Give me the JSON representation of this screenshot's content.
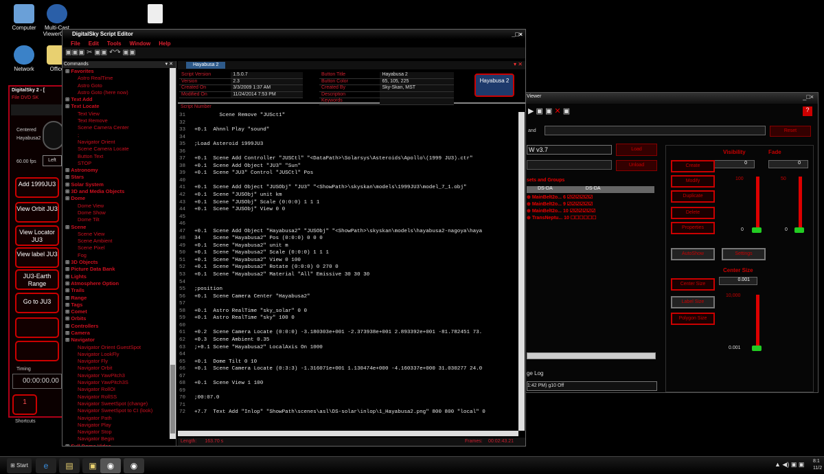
{
  "desktop": {
    "icons": [
      {
        "label": "Computer"
      },
      {
        "label": "Multi-Cast ViewerCast"
      },
      {
        "label": "Network"
      },
      {
        "label": "Office"
      }
    ]
  },
  "dome": {
    "title": "DigitalSky 2 - [",
    "menu": "File  DVD  SK",
    "label_center": "Centered",
    "label_obj": "Hayabusa2",
    "fps": "60.00 fps",
    "mode": "Left",
    "buttons": [
      "Add 1999JU3",
      "View Orbit JU3",
      "View Locator JU3",
      "View label JU3",
      "JU3-Earth Range",
      "Go to JU3"
    ],
    "timing_label": "Timing",
    "timecode": "00:00:00.00",
    "counter": "1",
    "footer": "Shortcuts"
  },
  "editor": {
    "title": "DigitalSky Script Editor",
    "menu": [
      "File",
      "Edit",
      "Tools",
      "Window",
      "Help"
    ],
    "panel_title": "Commands",
    "tab": "Hayabusa 2",
    "tree": [
      {
        "t": "Favorites",
        "c": 1
      },
      {
        "t": "Astro RealTime"
      },
      {
        "t": "Astro Goto"
      },
      {
        "t": "Astro Goto (here now)"
      },
      {
        "t": "Text Add",
        "c": 1
      },
      {
        "t": "Text Locate",
        "c": 1
      },
      {
        "t": "Text View"
      },
      {
        "t": "Text Remove"
      },
      {
        "t": "Scene Camera Center"
      },
      {
        "t": ";"
      },
      {
        "t": "Navigator Orient"
      },
      {
        "t": "Scene Camera Locate"
      },
      {
        "t": "Button Text"
      },
      {
        "t": "STOP"
      },
      {
        "t": "Astronomy",
        "c": 1
      },
      {
        "t": "Stars",
        "c": 1
      },
      {
        "t": "Solar System",
        "c": 1
      },
      {
        "t": "3D and Media Objects",
        "c": 1
      },
      {
        "t": "Dome",
        "c": 1
      },
      {
        "t": "Dome View"
      },
      {
        "t": "Dome Show"
      },
      {
        "t": "Dome Tilt"
      },
      {
        "t": "Scene",
        "c": 1
      },
      {
        "t": "Scene View"
      },
      {
        "t": "Scene Ambient"
      },
      {
        "t": "Scene Pixel"
      },
      {
        "t": "Fog"
      },
      {
        "t": "3D Objects",
        "c": 1
      },
      {
        "t": "Picture Data Bank",
        "c": 1
      },
      {
        "t": "Lights",
        "c": 1
      },
      {
        "t": "Atmosphere Option",
        "c": 1
      },
      {
        "t": "Trails",
        "c": 1
      },
      {
        "t": "Range",
        "c": 1
      },
      {
        "t": "Tags",
        "c": 1
      },
      {
        "t": "Comet",
        "c": 1
      },
      {
        "t": "Orbits",
        "c": 1
      },
      {
        "t": "Controllers",
        "c": 1
      },
      {
        "t": "Camera",
        "c": 1
      },
      {
        "t": "Navigator",
        "c": 1
      },
      {
        "t": "Navigator Orient GuestSpot"
      },
      {
        "t": "Navigator LookFly"
      },
      {
        "t": "Navigator Fly"
      },
      {
        "t": "Navigator Orbit"
      },
      {
        "t": "Navigator YawPitch3"
      },
      {
        "t": "Navigator YawPitch3S"
      },
      {
        "t": "Navigator RollOI"
      },
      {
        "t": "Navigator RollSS"
      },
      {
        "t": "Navigator SweetSpot (change)"
      },
      {
        "t": "Navigator SweetSpot to CI (look)"
      },
      {
        "t": "Navigator Path"
      },
      {
        "t": "Navigator Play"
      },
      {
        "t": "Navigator Stop"
      },
      {
        "t": "Navigator Begin"
      },
      {
        "t": "Full Dome Video",
        "c": 1
      }
    ],
    "props_left": [
      [
        "Script Version",
        "1.5.0.7"
      ],
      [
        "Version",
        "2.3"
      ],
      [
        "Created On",
        "3/3/2009 1:37 AM"
      ],
      [
        "Modified On",
        "11/24/2014 7:53 PM"
      ]
    ],
    "props_right": [
      [
        "Button Title",
        "Hayabusa 2"
      ],
      [
        "Button Color",
        "65, 105, 225"
      ],
      [
        "Created By",
        "Sky-Skan, MST"
      ],
      [
        "Description",
        ""
      ],
      [
        "Keywords",
        ""
      ]
    ],
    "button_preview": "Hayabusa 2",
    "script_header": "Script Number",
    "lines": [
      [
        "31",
        "        Scene Remove \"JUSct1\""
      ],
      [
        "32",
        ""
      ],
      [
        "33",
        "+0.1  Ahnnl Play \"sound\""
      ],
      [
        "34",
        ""
      ],
      [
        "35",
        ";Load Asteroid 1999JU3"
      ],
      [
        "36",
        ""
      ],
      [
        "37",
        "+0.1  Scene Add Controller \"JUSCtl\" \"<DataPath>\\Solarsys\\Asteroids\\Apollo\\(1999 JU3).ctr\""
      ],
      [
        "38",
        "+0.1  Scene Add Object \"JU3\" \"Sun\""
      ],
      [
        "39",
        "+0.1  Scene \"JU3\" Control \"JUSCtl\" Pos"
      ],
      [
        "40",
        ""
      ],
      [
        "41",
        "+0.1  Scene Add Object \"JUSObj\" \"JU3\" \"<ShowPath>\\skyskan\\models\\1999JU3\\model_7_1.obj\""
      ],
      [
        "42",
        "+0.1  Scene \"JUSObj\" unit km"
      ],
      [
        "43",
        "+0.1  Scene \"JUSObj\" Scale (0:0:0) 1 1 1"
      ],
      [
        "44",
        "+0.1  Scene \"JUSObj\" View 0 0"
      ],
      [
        "45",
        ""
      ],
      [
        "46",
        ""
      ],
      [
        "47",
        "+0.1  Scene Add Object \"Hayabusa2\" \"JUSObj\" \"<ShowPath>\\skyskan\\models\\hayabusa2-nagoya\\haya"
      ],
      [
        "48",
        "34    Scene \"Hayabusa2\" Pos (0:0:0) 0 0 0"
      ],
      [
        "49",
        "+0.1  Scene \"Hayabusa2\" unit m"
      ],
      [
        "50",
        "+0.1  Scene \"Hayabusa2\" Scale (0:0:0) 1 1 1"
      ],
      [
        "51",
        "+0.1  Scene \"Hayabusa2\" View 0 100"
      ],
      [
        "52",
        "+0.1  Scene \"Hayabusa2\" Rotate (0:0:0) 0 270 0"
      ],
      [
        "53",
        "+0.1  Scene \"Hayabusa2\" Material \"All\" Emissive 30 30 30"
      ],
      [
        "54",
        ""
      ],
      [
        "55",
        ";position"
      ],
      [
        "56",
        "+0.1  Scene Camera Center \"Hayabusa2\""
      ],
      [
        "57",
        ""
      ],
      [
        "58",
        "+0.1  Astro RealTime \"sky_solar\" 0 0"
      ],
      [
        "59",
        "+0.1  Astro RealTime \"sky\" 100 0"
      ],
      [
        "60",
        ""
      ],
      [
        "61",
        "+0.2  Scene Camera Locate (0:0:0) -3.180303e+001 -2.373938e+001 2.893392e+001 -81.782451 73."
      ],
      [
        "62",
        "+0.3  Scene Ambient 0.35"
      ],
      [
        "63",
        ";+0.1 Scene \"Hayabusa2\" LocalAxis On 1000"
      ],
      [
        "64",
        ""
      ],
      [
        "65",
        "+0.1  Dome Tilt 0 10"
      ],
      [
        "66",
        "+0.1  Scene Camera Locate (0:3:3) -1.316071e+001 1.130474e+000 -4.160337e+000 31.030277 24.0"
      ],
      [
        "67",
        ""
      ],
      [
        "68",
        "+0.1  Scene View 1 100"
      ],
      [
        "69",
        ""
      ],
      [
        "70",
        ";00:07.0"
      ],
      [
        "71",
        ""
      ],
      [
        "72",
        "+7.7  Text Add \"Inlop\" \"ShowPath\\scenes\\asl\\DS-solar\\inlop\\1_Hayabusa2.png\" 800 800 \"local\" 0"
      ]
    ],
    "length_label": "Length:",
    "length_value": "163.70 s",
    "frames_label": "Frames:",
    "frames_value": "00:02:43.21"
  },
  "viewer": {
    "title": "Viewer",
    "cmd_label": "and",
    "reset": "Reset",
    "object": "W v3.7",
    "load": "Load",
    "unload": "Unload",
    "sets_title": "sets and Groups",
    "col1": "DS-DA",
    "col2": "DS-DA",
    "rows": [
      {
        "name": "MainBelt2o...",
        "n": "6"
      },
      {
        "name": "MainBelt2o...",
        "n": "9"
      },
      {
        "name": "MainBelt2o...",
        "n": "10"
      },
      {
        "name": "TransNeptu...",
        "n": "10"
      }
    ],
    "visibility": "Visibility",
    "fade": "Fade",
    "vis_value": "0",
    "fade_value": "0",
    "v100": "100",
    "f50": "50",
    "v0": "0",
    "f0": "0",
    "side_buttons": [
      "Create",
      "Modify",
      "Duplicate",
      "Delete",
      "Properties"
    ],
    "autoshow": "AutoShow",
    "settings": "Settings",
    "center_size": "Center Size",
    "cs_value": "0.001",
    "cs_top": "10,000",
    "cs_bot": "0.001",
    "btn_a": "Center Size",
    "btn_b": "Label Size",
    "btn_c": "Polygon Size",
    "log_title": "ge Log",
    "log_value": "1:42 PM) g10 Off"
  },
  "taskbar": {
    "start": "Start",
    "clock": "8:1",
    "date": "11/2"
  }
}
